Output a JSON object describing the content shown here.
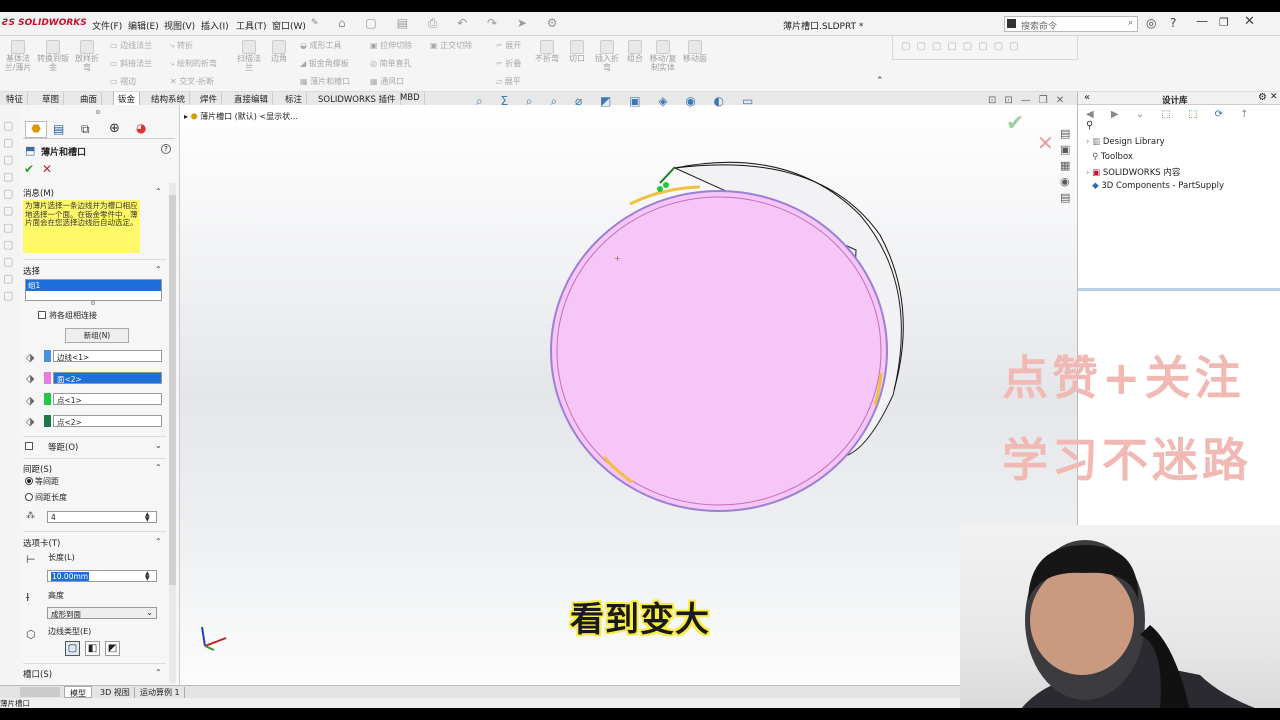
{
  "app": {
    "logo": "SOLIDWORKS",
    "document_title": "薄片槽口.SLDPRT *"
  },
  "menu": [
    "文件(F)",
    "编辑(E)",
    "视图(V)",
    "插入(I)",
    "工具(T)",
    "窗口(W)"
  ],
  "search": {
    "placeholder": "搜索命令"
  },
  "ribbon": {
    "big_buttons": [
      "基体法兰/薄片",
      "转换到钣金",
      "放样折弯",
      "边角",
      "扫描法兰",
      "拉伸切除",
      "展开",
      "折叠",
      "不折弯",
      "切口",
      "插入折弯",
      "组合",
      "移动/复制实体",
      "移动面"
    ],
    "small_buttons": [
      "边线法兰",
      "斜接法兰",
      "褶边",
      "转折",
      "绘制的折弯",
      "交叉-折断",
      "成形工具",
      "钣金角撑板",
      "薄片和槽口",
      "正交切除",
      "简单直孔",
      "通风口",
      "展平"
    ]
  },
  "tabs": [
    "特征",
    "草图",
    "曲面",
    "钣金",
    "结构系统",
    "焊件",
    "直接编辑",
    "标注",
    "SOLIDWORKS 插件",
    "MBD"
  ],
  "active_tab": "钣金",
  "panel": {
    "title": "薄片和槽口",
    "message_header": "消息(M)",
    "message": "为薄片选择一条边线并为槽口相应地选择一个面。在钣金零件中，薄片面会在您选择边线后自动选定。",
    "selection_header": "选择",
    "group_item": "组1",
    "connect_groups": "将各组相连接",
    "new_group": "新组(N)",
    "selections": [
      "边线<1>",
      "面<2>",
      "点<1>",
      "点<2>"
    ],
    "equal_spacing": "等距(O)",
    "spacing_header": "间距(S)",
    "opt_equal": "等间距",
    "opt_length": "间距长度",
    "spacing_value": "4",
    "tab_header": "选项卡(T)",
    "length_label": "长度(L)",
    "length_value": "10.00mm",
    "height_label": "高度",
    "height_value": "成形到面",
    "edge_type_label": "边线类型(E)",
    "slot_header": "槽口(S)"
  },
  "breadcrumb": "薄片槽口 (默认) <显示状...",
  "taskpane": {
    "title": "设计库",
    "items": [
      "Design Library",
      "Toolbox",
      "SOLIDWORKS 内容",
      "3D Components - PartSupply"
    ]
  },
  "bottom_tabs": [
    "模型",
    "3D 视图",
    "运动算例 1"
  ],
  "status": "薄片槽口",
  "overlay": {
    "subtitle": "看到变大",
    "watermark_line1": "点赞+关注",
    "watermark_line2": "学习不迷路"
  },
  "colors": {
    "accent": "#1e6fd9",
    "face_fill": "#f6c6f6",
    "selection_yellow": "#f7f2a0"
  }
}
